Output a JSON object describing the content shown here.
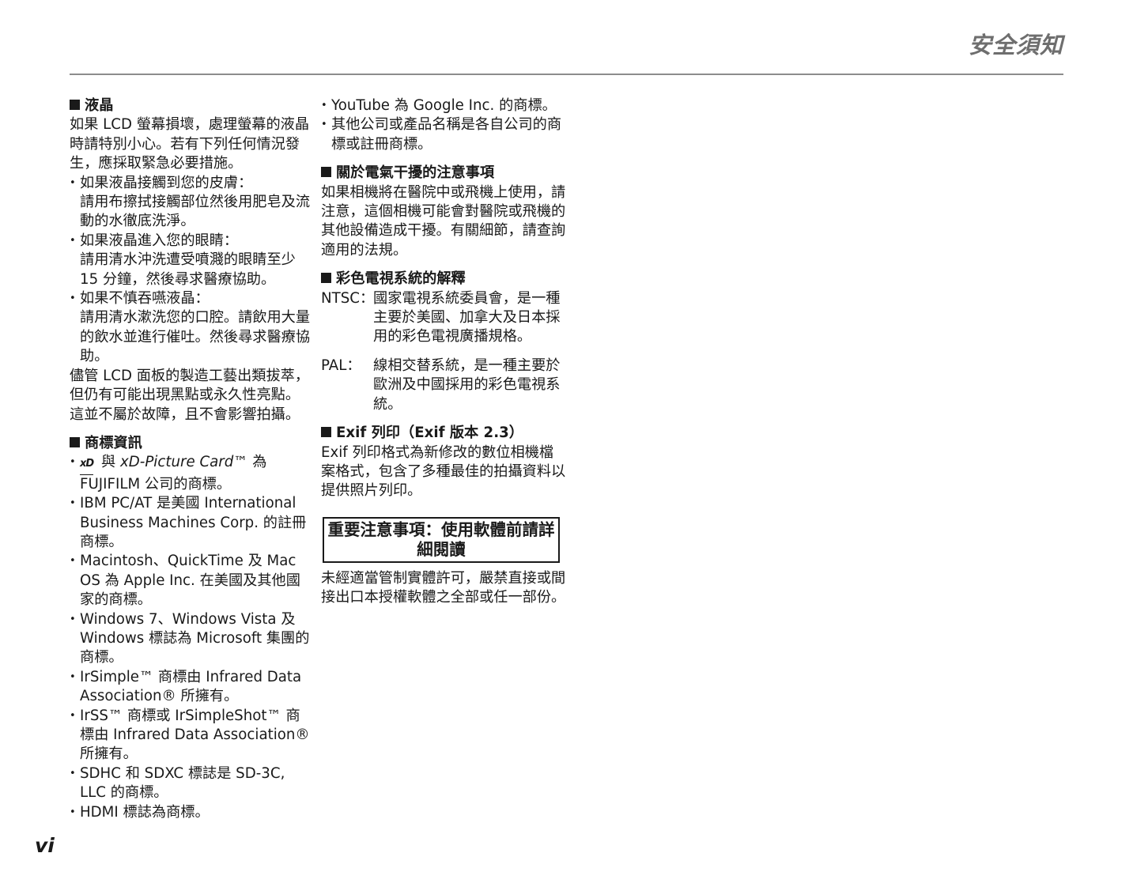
{
  "header": {
    "title": "安全須知"
  },
  "page_number": "vi",
  "col1": {
    "lcd": {
      "title": "液晶",
      "intro": "如果 LCD 螢幕損壞，處理螢幕的液晶時請特別小心。若有下列任何情況發生，應採取緊急必要措施。",
      "items": [
        {
          "head": "如果液晶接觸到您的皮膚：",
          "body": "請用布擦拭接觸部位然後用肥皂及流動的水徹底洗淨。"
        },
        {
          "head": "如果液晶進入您的眼睛：",
          "body": "請用清水沖洗遭受噴濺的眼睛至少 15 分鐘，然後尋求醫療協助。"
        },
        {
          "head": "如果不慎吞嚥液晶：",
          "body": "請用清水漱洗您的口腔。請飲用大量的飲水並進行催吐。然後尋求醫療協助。"
        }
      ],
      "outro": "儘管 LCD 面板的製造工藝出類拔萃，但仍有可能出現黑點或永久性亮點。這並不屬於故障，且不會影響拍攝。"
    },
    "trademark": {
      "title": "商標資訊",
      "xd_logo": "xD",
      "xd_and": "與",
      "xd_name": "xD-Picture Card™",
      "xd_rest": "為 FUJIFILM 公司的商標。",
      "items": [
        "IBM PC/AT 是美國 International Business Machines Corp. 的註冊商標。",
        "Macintosh、QuickTime 及 Mac OS 為 Apple Inc. 在美國及其他國家的商標。",
        "Windows 7、Windows Vista 及 Windows 標誌為 Microsoft 集團的商標。",
        "IrSimple™ 商標由 Infrared Data Association® 所擁有。",
        "IrSS™ 商標或 IrSimpleShot™ 商標由 Infrared Data Association® 所擁有。",
        "SDHC 和 SDXC 標誌是 SD-3C, LLC 的商標。",
        "HDMI 標誌為商標。"
      ]
    }
  },
  "col2": {
    "trademark_cont": [
      "YouTube 為 Google Inc. 的商標。",
      "其他公司或產品名稱是各自公司的商標或註冊商標。"
    ],
    "interference": {
      "title": "關於電氣干擾的注意事項",
      "body": "如果相機將在醫院中或飛機上使用，請注意，這個相機可能會對醫院或飛機的其他設備造成干擾。有關細節，請查詢適用的法規。"
    },
    "tv": {
      "title": "彩色電視系統的解釋",
      "defs": [
        {
          "term": "NTSC：",
          "desc": "國家電視系統委員會，是一種主要於美國、加拿大及日本採用的彩色電視廣播規格。"
        },
        {
          "term": "PAL：",
          "desc": "線相交替系統，是一種主要於歐洲及中國採用的彩色電視系統。"
        }
      ]
    },
    "exif": {
      "title": "Exif 列印（Exif 版本 2.3）",
      "body": "Exif 列印格式為新修改的數位相機檔案格式，包含了多種最佳的拍攝資料以提供照片列印。"
    },
    "notice": {
      "title": "重要注意事項：使用軟體前請詳細閱讀",
      "body": "未經適當管制實體許可，嚴禁直接或間接出口本授權軟體之全部或任一部份。"
    }
  }
}
